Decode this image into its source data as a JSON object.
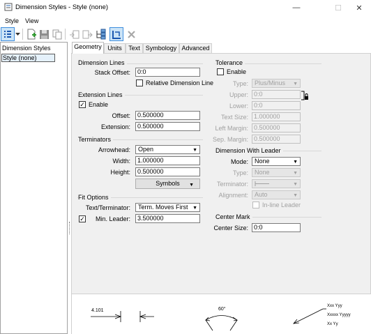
{
  "window": {
    "title": "Dimension Styles - Style (none)",
    "minimize": "—",
    "maximize": "☐",
    "close": "✕"
  },
  "menu": {
    "style": "Style",
    "view": "View"
  },
  "toolbar": {
    "icons": [
      "list-view-icon",
      "dropdown-arrow-icon",
      "new-style-icon",
      "save-icon",
      "copy-icon",
      "import-icon",
      "export-icon",
      "hierarchy-icon",
      "match-icon",
      "delete-icon"
    ]
  },
  "left_panel": {
    "header": "Dimension Styles",
    "items": [
      "Style (none)"
    ]
  },
  "tabs": [
    "Geometry",
    "Units",
    "Text",
    "Symbology",
    "Advanced"
  ],
  "geometry": {
    "dimension_lines": {
      "title": "Dimension Lines",
      "stack_offset_label": "Stack Offset:",
      "stack_offset_value": "0:0",
      "relative_label": "Relative Dimension Line",
      "relative_checked": false
    },
    "extension_lines": {
      "title": "Extension Lines",
      "enable_label": "Enable",
      "enable_checked": true,
      "offset_label": "Offset:",
      "offset_value": "0.500000",
      "extension_label": "Extension:",
      "extension_value": "0.500000"
    },
    "terminators": {
      "title": "Terminators",
      "arrowhead_label": "Arrowhead:",
      "arrowhead_value": "Open",
      "width_label": "Width:",
      "width_value": "1.000000",
      "height_label": "Height:",
      "height_value": "0.500000",
      "symbols_button": "Symbols"
    },
    "fit_options": {
      "title": "Fit Options",
      "text_terminator_label": "Text/Terminator:",
      "text_terminator_value": "Term. Moves First",
      "min_leader_label": "Min. Leader:",
      "min_leader_checked": true,
      "min_leader_value": "3.500000"
    },
    "tolerance": {
      "title": "Tolerance",
      "enable_label": "Enable",
      "enable_checked": false,
      "type_label": "Type:",
      "type_value": "Plus/Minus",
      "upper_label": "Upper:",
      "upper_value": "0:0",
      "lower_label": "Lower:",
      "lower_value": "0:0",
      "text_size_label": "Text Size:",
      "text_size_value": "1.000000",
      "left_margin_label": "Left Margin:",
      "left_margin_value": "0.500000",
      "sep_margin_label": "Sep. Margin:",
      "sep_margin_value": "0.500000"
    },
    "dimension_with_leader": {
      "title": "Dimension With Leader",
      "mode_label": "Mode:",
      "mode_value": "None",
      "type_label": "Type:",
      "type_value": "None",
      "terminator_label": "Terminator:",
      "alignment_label": "Alignment:",
      "alignment_value": "Auto",
      "inline_leader_label": "In-line Leader",
      "inline_leader_checked": false
    },
    "center_mark": {
      "title": "Center Mark",
      "center_size_label": "Center Size:",
      "center_size_value": "0:0"
    }
  },
  "preview": {
    "linear_value": "4.101",
    "angular_value": "60°",
    "leader_line1": "Xxx Yyy",
    "leader_line2": "Xxxxx Yyyyy",
    "leader_line3": "Xx Yy"
  }
}
